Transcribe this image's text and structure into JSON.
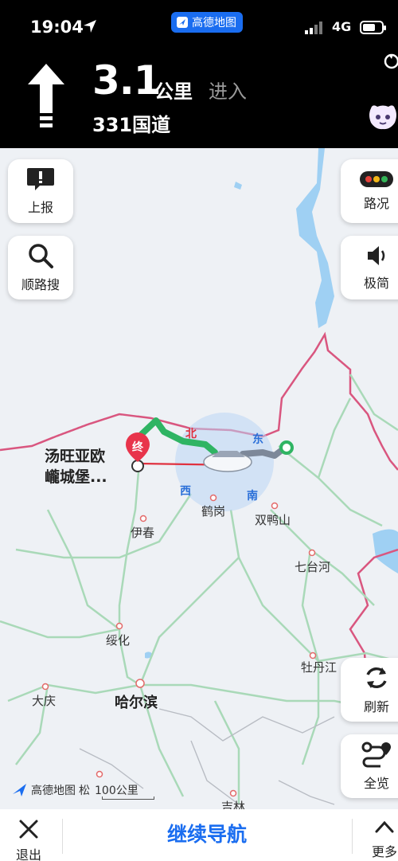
{
  "status": {
    "time": "19:04",
    "app_badge": "高德地图",
    "network": "4G"
  },
  "nav": {
    "distance": "3.1",
    "unit": "公里",
    "action": "进入",
    "road": "331国道"
  },
  "buttons": {
    "report": "上报",
    "search_along": "顺路搜",
    "traffic": "路况",
    "simple": "极简",
    "refresh": "刷新",
    "overview": "全览"
  },
  "map": {
    "destination": [
      "汤旺亚欧",
      "巄城堡..."
    ],
    "end_marker": "终",
    "compass": {
      "north": "北",
      "east": "东",
      "south": "南",
      "west": "西"
    },
    "cities": {
      "hegang": "鹤岗",
      "shuangyashan": "双鸭山",
      "yichun": "伊春",
      "qitaihe": "七台河",
      "suihua": "绥化",
      "mudanjiang": "牡丹江",
      "daqing": "大庆",
      "harbin": "哈尔滨",
      "jilin": "吉林"
    },
    "scale_brand": "高德地图",
    "scale_partial": "松",
    "scale": "100公里"
  },
  "bottom": {
    "exit": "退出",
    "continue": "继续导航",
    "more": "更多"
  },
  "colors": {
    "brand_blue": "#1a6df0",
    "route_green": "#2fb463",
    "border_pink": "#d9567f",
    "water": "#9fd0f3"
  }
}
